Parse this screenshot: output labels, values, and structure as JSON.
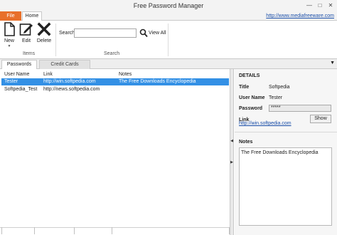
{
  "window": {
    "title": "Free Password Manager"
  },
  "ribbon_tabs": [
    {
      "label": "File"
    },
    {
      "label": "Home"
    }
  ],
  "site_link": "http://www.mediafreeware.com",
  "items_group": {
    "label": "Items",
    "buttons": [
      {
        "label": "New",
        "icon": "new-document-icon"
      },
      {
        "label": "Edit",
        "icon": "edit-icon"
      },
      {
        "label": "Delete",
        "icon": "delete-x-icon"
      }
    ]
  },
  "search_group": {
    "label": "Search",
    "field_label": "Search",
    "value": "",
    "view_all": "View All"
  },
  "content_tabs": [
    {
      "label": "Passwords"
    },
    {
      "label": "Credit Cards"
    }
  ],
  "table": {
    "columns": [
      "User Name",
      "Link",
      "Notes"
    ],
    "rows": [
      {
        "user": "Tester",
        "link": "http://win.softpedia.com",
        "notes": "The Free Downloads Encyclopedia",
        "selected": true
      },
      {
        "user": "Softpedia_Test",
        "link": "http://news.softpedia.com",
        "notes": "",
        "selected": false
      }
    ]
  },
  "details": {
    "header": "DETAILS",
    "title_label": "Title",
    "title_value": "Softpedia",
    "user_label": "User Name",
    "user_value": "Tester",
    "password_label": "Password",
    "password_value": "*****",
    "show_label": "Show",
    "link_label": "Link",
    "link_value": "http://win.softpedia.com",
    "notes_label": "Notes",
    "notes_value": "The Free Downloads Encyclopedia"
  },
  "colors": {
    "file_tab": "#e8702a",
    "selection": "#3390e5",
    "link": "#1a4ea8"
  }
}
